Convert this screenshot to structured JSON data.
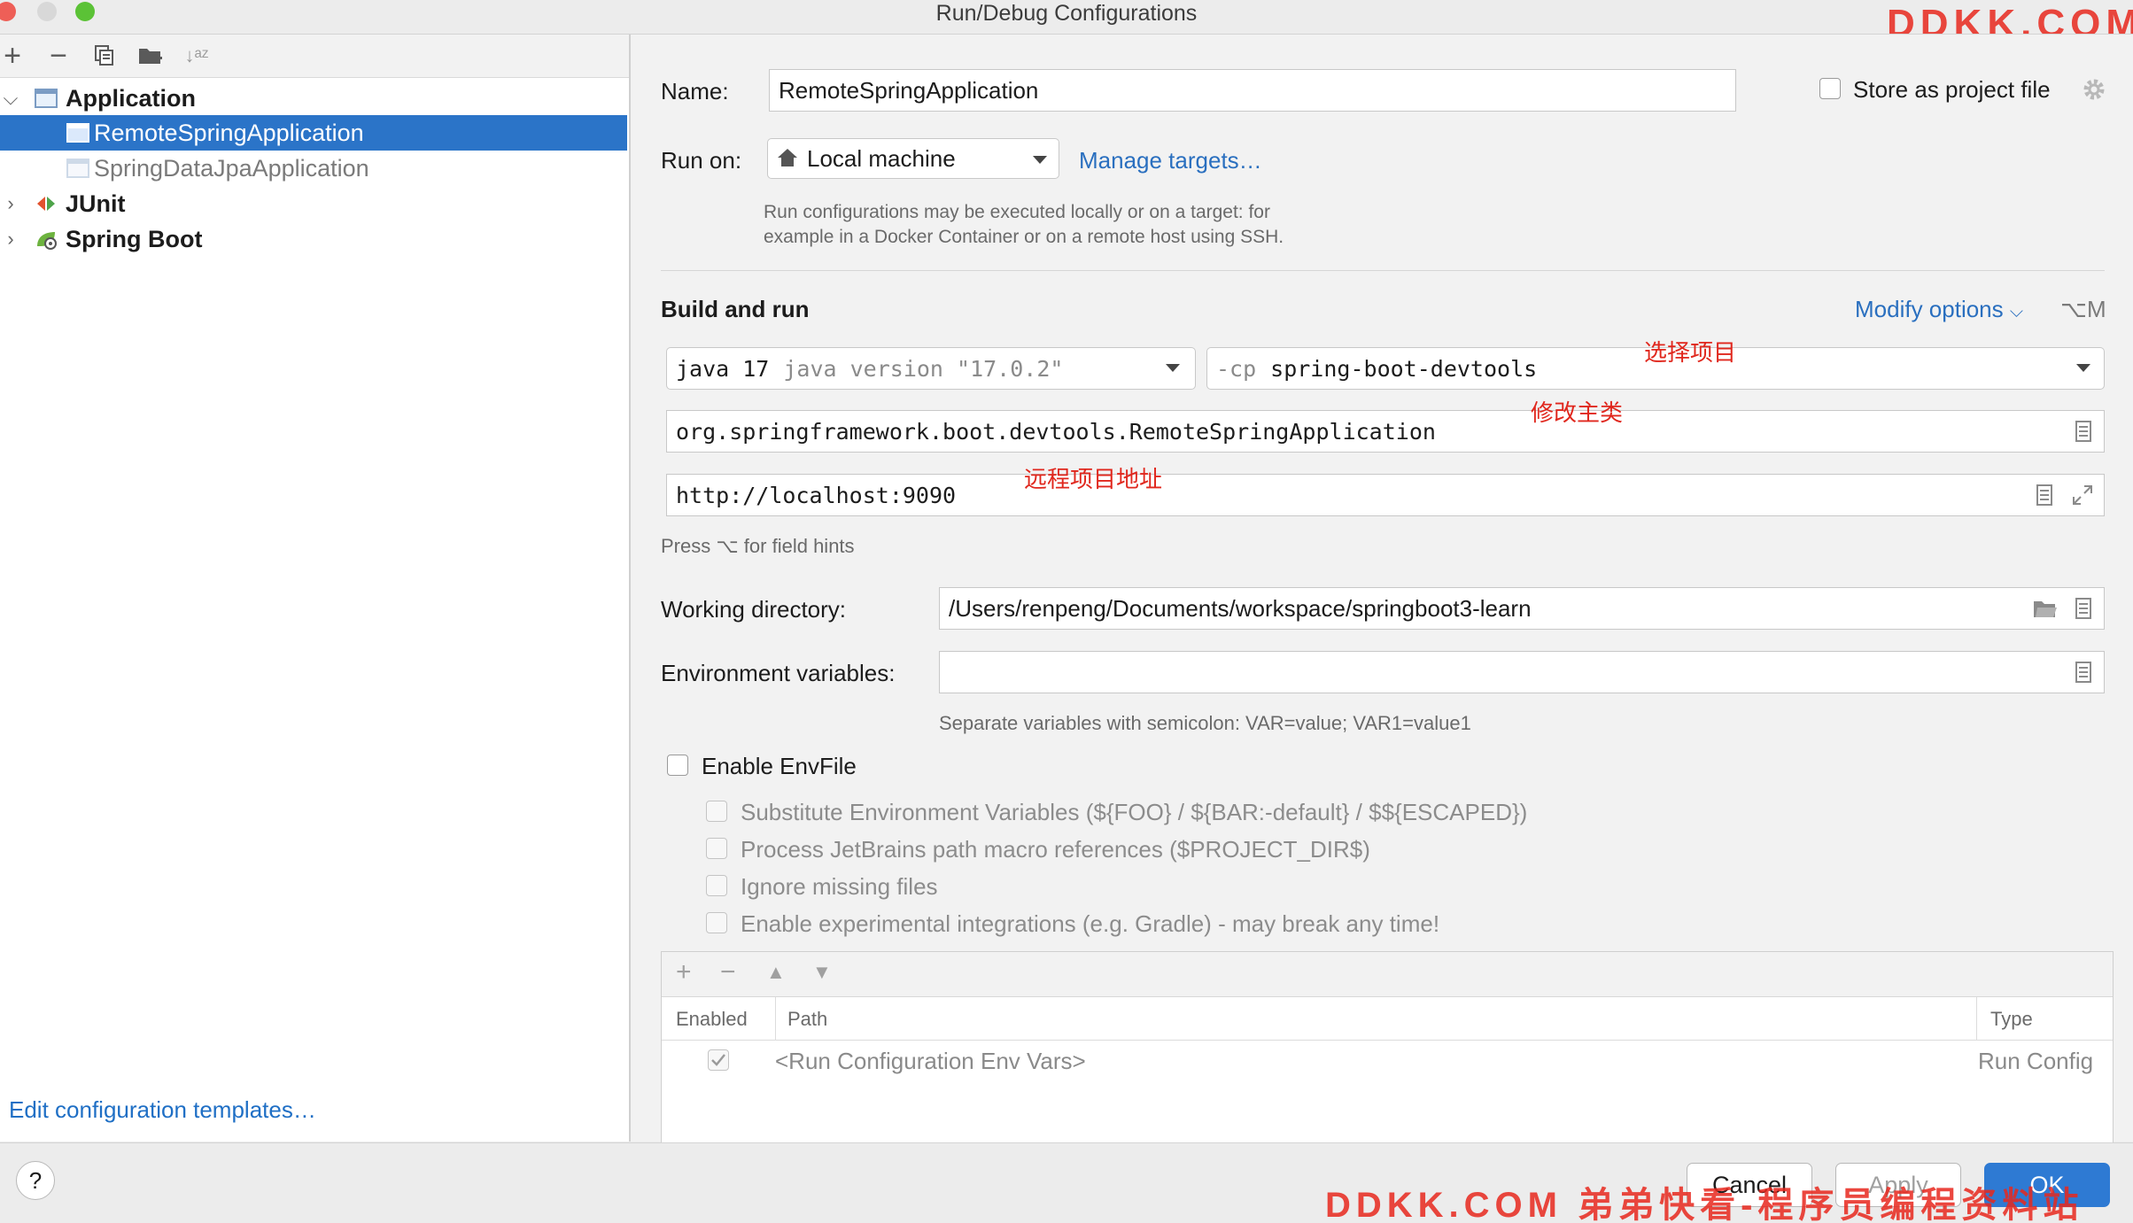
{
  "window": {
    "title": "Run/Debug Configurations"
  },
  "colors": {
    "accent": "#2a6fbf",
    "selection": "#2b74c8",
    "annotation": "#e0271d"
  },
  "left_toolbar": {
    "icons": [
      "plus-icon",
      "minus-icon",
      "copy-icon",
      "folder-add-icon",
      "sort-icon"
    ],
    "add": "+",
    "remove": "−",
    "sort": "↓ᵃᶻ"
  },
  "tree": {
    "application": "Application",
    "remote_app": "RemoteSpringApplication",
    "jpa_app": "SpringDataJpaApplication",
    "junit": "JUnit",
    "spring_boot": "Spring Boot"
  },
  "edit_templates": "Edit configuration templates…",
  "form": {
    "name_label": "Name:",
    "name_value": "RemoteSpringApplication",
    "store_label": "Store as project file",
    "run_on_label": "Run on:",
    "run_on_value": "Local machine",
    "manage_targets": "Manage targets…",
    "run_on_hint_1": "Run configurations may be executed locally or on a target: for",
    "run_on_hint_2": "example in a Docker Container or on a remote host using SSH.",
    "build_and_run": "Build and run",
    "modify_options": "Modify options",
    "modify_shortcut": "⌥M",
    "jdk_bold": "java 17",
    "jdk_dim": "java version \"17.0.2\"",
    "cp_prefix": "-cp",
    "cp_value": "spring-boot-devtools",
    "main_class": "org.springframework.boot.devtools.RemoteSpringApplication",
    "program_args": "http://localhost:9090",
    "field_hints": "Press ⌥ for field hints",
    "working_dir_label": "Working directory:",
    "working_dir_value": "/Users/renpeng/Documents/workspace/springboot3-learn",
    "env_label": "Environment variables:",
    "env_value": "",
    "env_hint": "Separate variables with semicolon: VAR=value; VAR1=value1",
    "enable_envfile": "Enable EnvFile",
    "envfile_options": [
      "Substitute Environment Variables (${FOO} / ${BAR:-default} / $${ESCAPED})",
      "Process JetBrains path macro references ($PROJECT_DIR$)",
      "Ignore missing files",
      "Enable experimental integrations (e.g. Gradle) - may break any time!"
    ]
  },
  "annotations": {
    "select_project": "选择项目",
    "modify_main": "修改主类",
    "remote_addr": "远程项目地址"
  },
  "env_table": {
    "toolbar": [
      "+",
      "−",
      "▲",
      "▼"
    ],
    "headers": [
      "Enabled",
      "Path",
      "Type"
    ],
    "rows": [
      {
        "enabled": true,
        "path": "<Run Configuration Env Vars>",
        "type": "Run Config"
      }
    ]
  },
  "buttons": {
    "help": "?",
    "cancel": "Cancel",
    "apply": "Apply",
    "ok": "OK"
  },
  "watermarks": {
    "top": "DDKK.COM",
    "bottom": "DDKK.COM 弟弟快看-程序员编程资料站"
  }
}
